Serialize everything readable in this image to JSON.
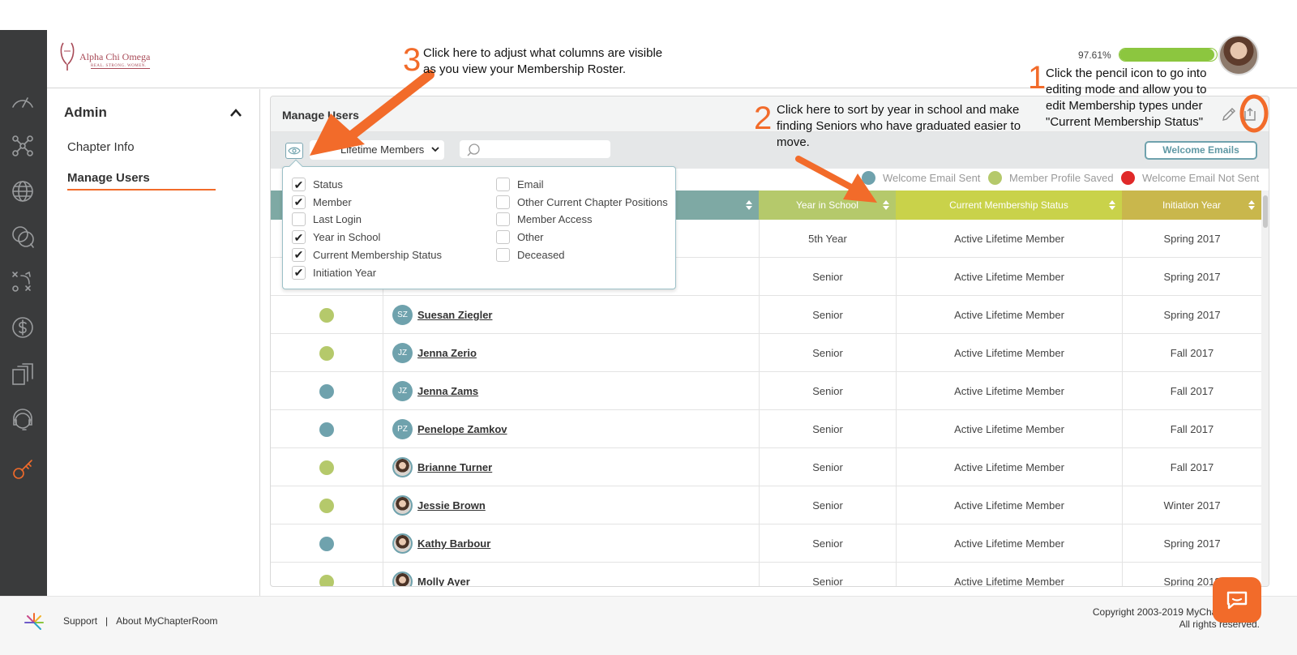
{
  "header": {
    "logo_name": "Alpha Chi Omega",
    "logo_tagline": "REAL. STRONG. WOMEN.",
    "profile_progress_text": "97.61%",
    "profile_progress": 97.61
  },
  "admin": {
    "title": "Admin",
    "links": [
      "Chapter Info",
      "Manage Users"
    ]
  },
  "card": {
    "title": "Manage Users",
    "filter_value": "Lifetime Members",
    "search_placeholder": "",
    "welcome_button": "Welcome Emails"
  },
  "legend": [
    {
      "label": "Welcome Email Sent",
      "color": "#6fa2ad"
    },
    {
      "label": "Member Profile Saved",
      "color": "#b5c96b"
    },
    {
      "label": "Welcome Email Not Sent",
      "color": "#e02929"
    }
  ],
  "columns": [
    {
      "label": "",
      "color": "#7ea9a4"
    },
    {
      "label": "",
      "color": "#7ea9a4"
    },
    {
      "label": "Year in School",
      "color": "#b5c96b"
    },
    {
      "label": "Current Membership Status",
      "color": "#c9d24a"
    },
    {
      "label": "Initiation Year",
      "color": "#c9b74c"
    }
  ],
  "rows": [
    {
      "status": "",
      "initials": "",
      "photo": false,
      "name": "",
      "year": "5th Year",
      "membership": "Active Lifetime Member",
      "initiation": "Spring 2017"
    },
    {
      "status": "",
      "initials": "",
      "photo": false,
      "name": "",
      "year": "Senior",
      "membership": "Active Lifetime Member",
      "initiation": "Spring 2017"
    },
    {
      "status": "#b5c96b",
      "initials": "SZ",
      "photo": false,
      "name": "Suesan Ziegler",
      "year": "Senior",
      "membership": "Active Lifetime Member",
      "initiation": "Spring 2017"
    },
    {
      "status": "#b5c96b",
      "initials": "JZ",
      "photo": false,
      "name": "Jenna Zerio",
      "year": "Senior",
      "membership": "Active Lifetime Member",
      "initiation": "Fall 2017"
    },
    {
      "status": "#6fa2ad",
      "initials": "JZ",
      "photo": false,
      "name": "Jenna Zams",
      "year": "Senior",
      "membership": "Active Lifetime Member",
      "initiation": "Fall 2017"
    },
    {
      "status": "#6fa2ad",
      "initials": "PZ",
      "photo": false,
      "name": "Penelope Zamkov",
      "year": "Senior",
      "membership": "Active Lifetime Member",
      "initiation": "Fall 2017"
    },
    {
      "status": "#b5c96b",
      "initials": "",
      "photo": true,
      "name": "Brianne Turner",
      "year": "Senior",
      "membership": "Active Lifetime Member",
      "initiation": "Fall 2017"
    },
    {
      "status": "#b5c96b",
      "initials": "",
      "photo": true,
      "name": "Jessie Brown",
      "year": "Senior",
      "membership": "Active Lifetime Member",
      "initiation": "Winter 2017"
    },
    {
      "status": "#6fa2ad",
      "initials": "",
      "photo": true,
      "name": "Kathy Barbour",
      "year": "Senior",
      "membership": "Active Lifetime Member",
      "initiation": "Spring 2017"
    },
    {
      "status": "#b5c96b",
      "initials": "",
      "photo": true,
      "name": "Molly Ayer",
      "year": "Senior",
      "membership": "Active Lifetime Member",
      "initiation": "Spring 2018"
    }
  ],
  "column_options": {
    "left": [
      {
        "label": "Status",
        "checked": true
      },
      {
        "label": "Member",
        "checked": true
      },
      {
        "label": "Last Login",
        "checked": false
      },
      {
        "label": "Year in School",
        "checked": true
      },
      {
        "label": "Current Membership Status",
        "checked": true
      },
      {
        "label": "Initiation Year",
        "checked": true
      }
    ],
    "right": [
      {
        "label": "Email",
        "checked": false
      },
      {
        "label": "Other Current Chapter Positions",
        "checked": false
      },
      {
        "label": "Member Access",
        "checked": false
      },
      {
        "label": "Other",
        "checked": false
      },
      {
        "label": "Deceased",
        "checked": false
      }
    ]
  },
  "annotations": {
    "a1_num": "1",
    "a1_text": "Click the pencil icon to go into editing mode and allow you to edit Membership types under \"Current Membership Status\"",
    "a2_num": "2",
    "a2_text": "Click here to sort by year in school and make finding Seniors who have graduated easier to move.",
    "a3_num": "3",
    "a3_text": "Click here to adjust what columns are visible as you view your Membership Roster."
  },
  "footer": {
    "support": "Support",
    "separator": "|",
    "about": "About MyChapterRoom",
    "copyright": "Copyright 2003-2019 MyChapterRoom",
    "rights": "All rights reserved."
  },
  "colors": {
    "accent": "#f26b2a",
    "teal": "#6fa2ad",
    "green": "#8cc63f"
  }
}
